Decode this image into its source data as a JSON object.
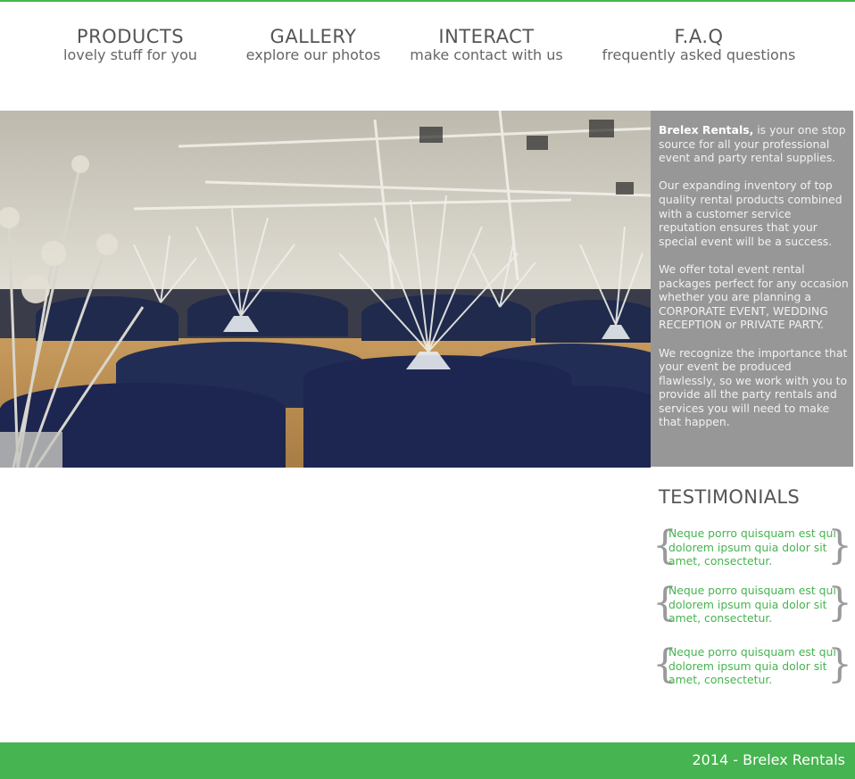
{
  "nav": [
    {
      "title": "PRODUCTS",
      "subtitle": "lovely stuff for you"
    },
    {
      "title": "GALLERY",
      "subtitle": "explore our photos"
    },
    {
      "title": "INTERACT",
      "subtitle": "make contact with us"
    },
    {
      "title": "F.A.Q",
      "subtitle": "frequently asked questions"
    }
  ],
  "info": {
    "brand": "Brelex Rentals,",
    "intro_rest": " is your one stop source for all your professional event and party rental supplies.",
    "p2": "Our expanding inventory of top quality rental products combined with a customer service reputation ensures that your special event will be a success.",
    "p3": "We offer total event rental packages perfect for any occasion whether you are planning a CORPORATE EVENT, WEDDING RECEPTION or PRIVATE PARTY.",
    "p4": "We recognize the importance that your event be produced flawlessly, so we work with you to provide all the party rentals and services you will need to make that happen."
  },
  "testimonials": {
    "title": "TESTIMONIALS",
    "open_brace": "{",
    "close_brace": "}",
    "items": [
      "Neque porro quisquam est qui dolorem ipsum quia dolor sit amet, consectetur.",
      "Neque porro quisquam est qui dolorem ipsum quia dolor sit amet, consectetur.",
      "Neque porro quisquam est qui dolorem ipsum quia dolor sit amet, consectetur."
    ]
  },
  "footer": {
    "text": "2014 - Brelex Rentals"
  },
  "colors": {
    "accent": "#46b450",
    "panel": "#808080",
    "text": "#555555"
  }
}
